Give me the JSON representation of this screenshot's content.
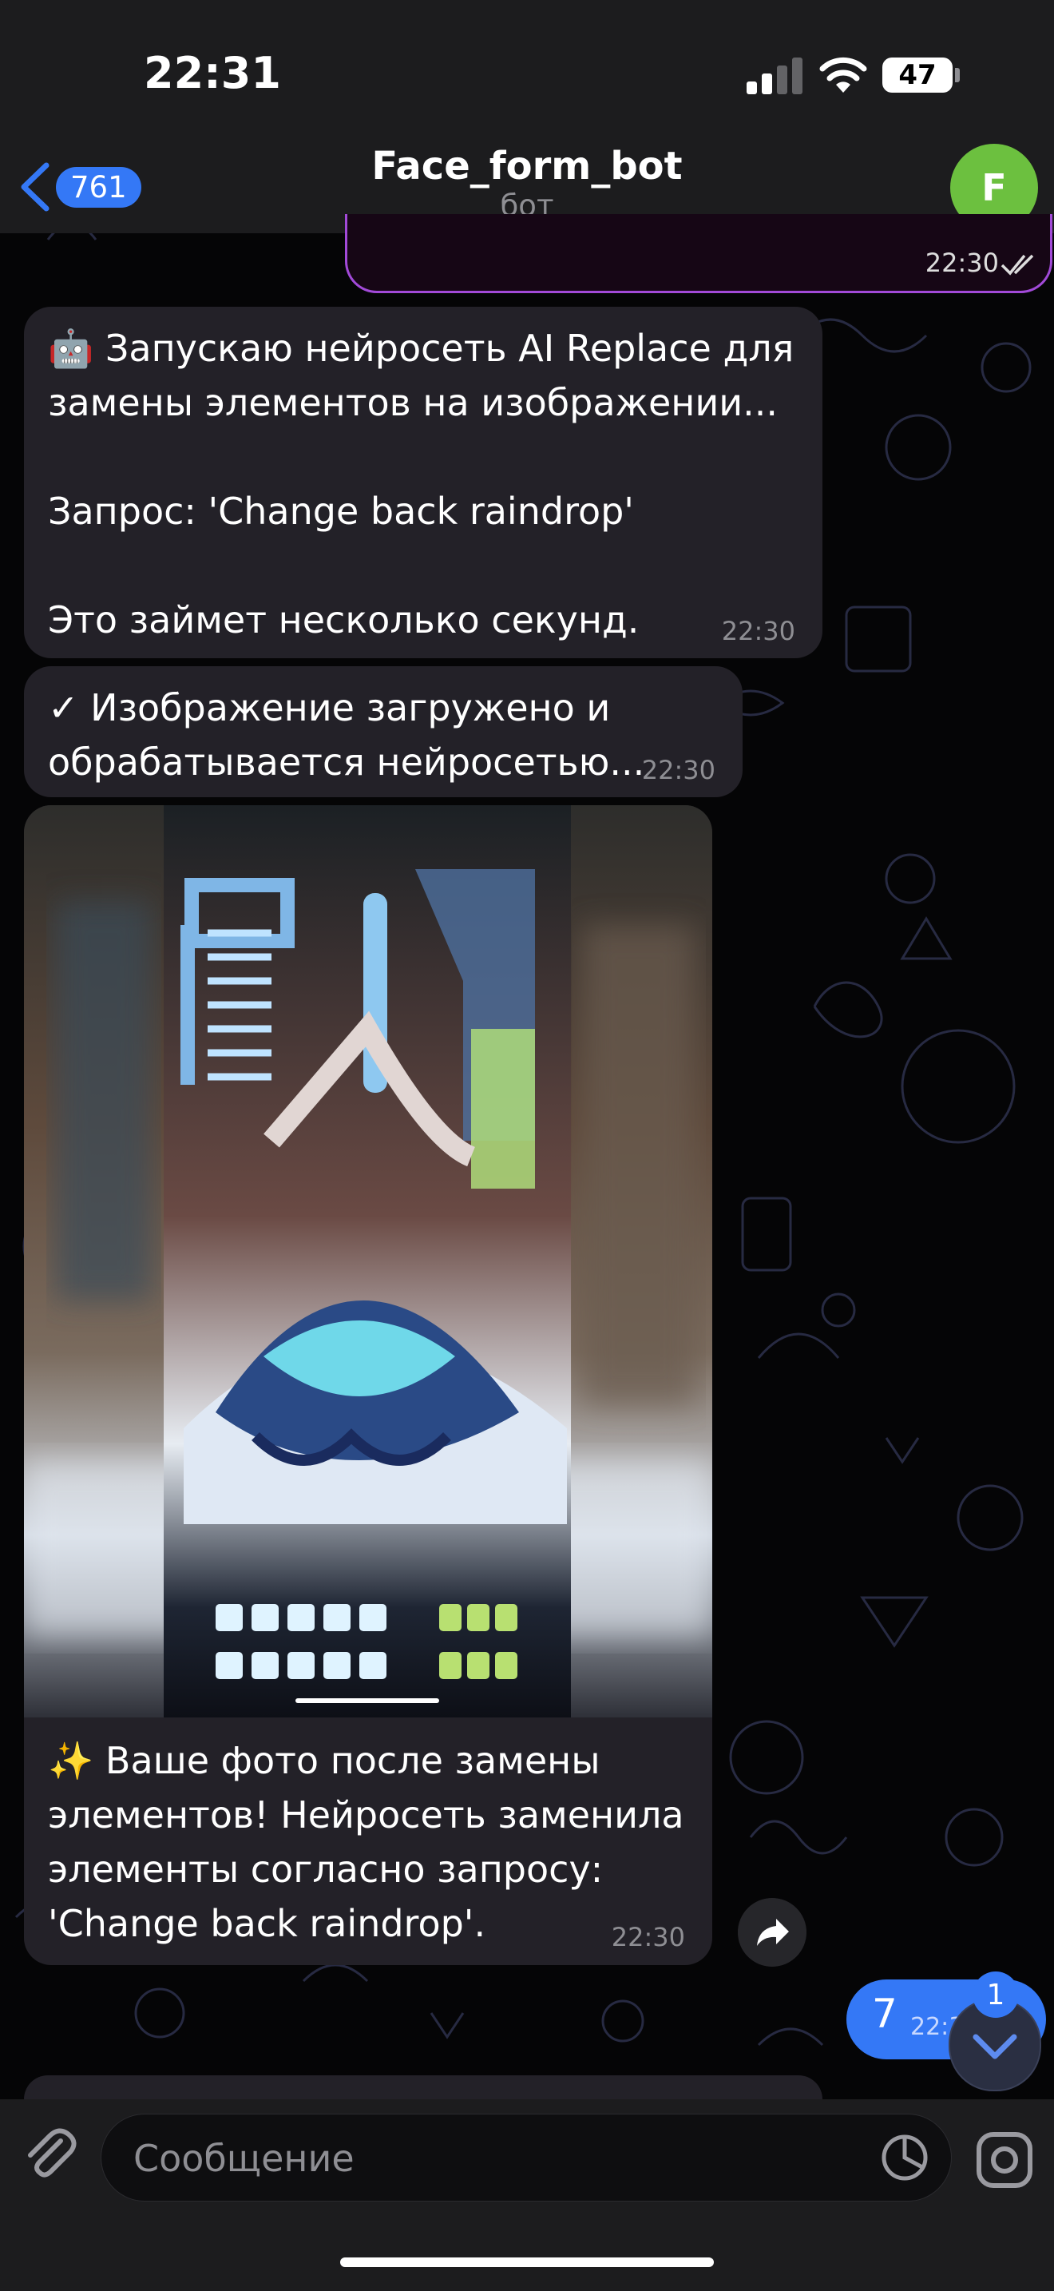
{
  "status_bar": {
    "time": "22:31",
    "battery": "47"
  },
  "header": {
    "back_count": "761",
    "title": "Face_form_bot",
    "subtitle": "бот",
    "avatar_letter": "F"
  },
  "messages": {
    "prev_time": "22:30",
    "m1": {
      "text": "🤖 Запускаю нейросеть AI Replace для\nзамены элементов на изображении...\n\nЗапрос: 'Change back raindrop'\n\nЭто займет несколько секунд.",
      "time": "22:30"
    },
    "m2": {
      "text": "✓ Изображение загружено и\nобрабатывается нейросетью...",
      "time": "22:30"
    },
    "m3": {
      "text": "✨ Ваше фото после замены\nэлементов! Нейросеть заменила\nэлементы согласно запросу:\n'Change back raindrop'.",
      "time": "22:30"
    },
    "outgoing": {
      "text": "7",
      "time": "22:3"
    }
  },
  "scroll_badge": "1",
  "input": {
    "placeholder": "Сообщение"
  },
  "colors": {
    "accent": "#3478f6",
    "bubble": "#232128",
    "bar": "#1c1c1e",
    "avatar": "#6cc03f",
    "doodle": "#2a2d45"
  },
  "icons": [
    "back-chevron-icon",
    "double-check-icon",
    "share-icon",
    "chevron-down-icon",
    "paperclip-icon",
    "sticker-icon",
    "camera-icon",
    "wifi-icon",
    "signal-icon"
  ]
}
